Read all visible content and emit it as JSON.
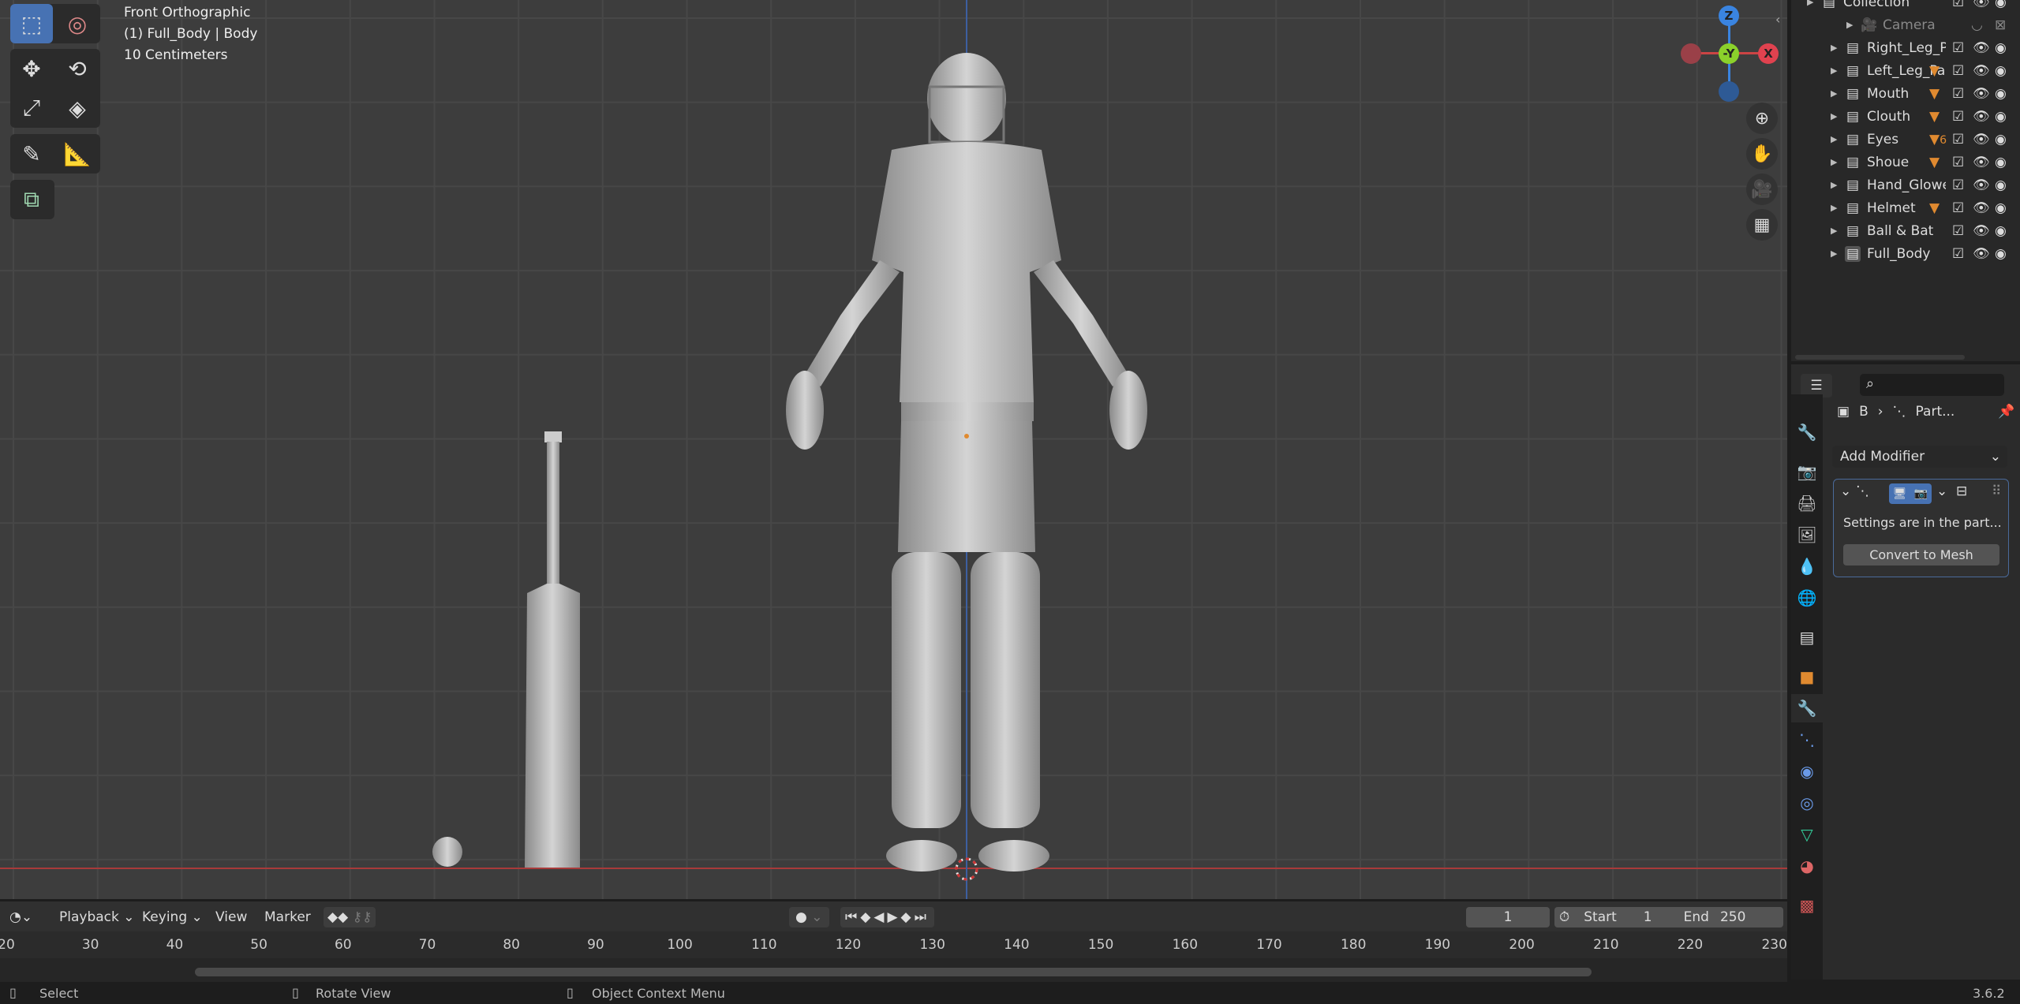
{
  "viewport": {
    "view_name": "Front Orthographic",
    "object_info": "(1) Full_Body | Body",
    "scale": "10 Centimeters",
    "gizmo": {
      "z": "Z",
      "y": "-Y",
      "x": "X",
      "colors": {
        "x": "#e0424f",
        "y": "#8bd12b",
        "z": "#3a84e0"
      }
    }
  },
  "toolbar": {
    "tools": [
      "select-box",
      "cursor",
      "move",
      "rotate",
      "scale",
      "transform",
      "annotate",
      "measure",
      "add-cube"
    ]
  },
  "outliner": {
    "rows": [
      {
        "label": "Collection",
        "kind": "collection",
        "top": true
      },
      {
        "label": "Camera",
        "kind": "camera"
      },
      {
        "label": "Right_Leg_P",
        "kind": "collection"
      },
      {
        "label": "Left_Leg_Pa",
        "kind": "collection",
        "mod": true
      },
      {
        "label": "Mouth",
        "kind": "collection",
        "mod": true
      },
      {
        "label": "Clouth",
        "kind": "collection",
        "mod": true
      },
      {
        "label": "Eyes",
        "kind": "collection",
        "mod": true,
        "badge": "6"
      },
      {
        "label": "Shoue",
        "kind": "collection",
        "mod": true
      },
      {
        "label": "Hand_Glowe",
        "kind": "collection"
      },
      {
        "label": "Helmet",
        "kind": "collection",
        "mod": true
      },
      {
        "label": "Ball & Bat",
        "kind": "collection"
      },
      {
        "label": "Full_Body",
        "kind": "collection",
        "active": true
      }
    ]
  },
  "properties": {
    "search_placeholder": "",
    "breadcrumb_object": "B",
    "breadcrumb_modifier": "Part...",
    "add_modifier": "Add Modifier",
    "modifier_message": "Settings are in the part...",
    "convert_button": "Convert to Mesh",
    "active_tab": "modifiers"
  },
  "timeline": {
    "menus": [
      "Playback",
      "Keying",
      "View",
      "Marker"
    ],
    "current_frame": "1",
    "start_label": "Start",
    "start": "1",
    "end_label": "End",
    "end": "250",
    "ticks": [
      "20",
      "30",
      "40",
      "50",
      "60",
      "70",
      "80",
      "90",
      "100",
      "110",
      "120",
      "130",
      "140",
      "150",
      "160",
      "170",
      "180",
      "190",
      "200",
      "210",
      "220",
      "230"
    ]
  },
  "status": {
    "select": "Select",
    "rotate": "Rotate View",
    "context": "Object Context Menu",
    "version": "3.6.2"
  }
}
